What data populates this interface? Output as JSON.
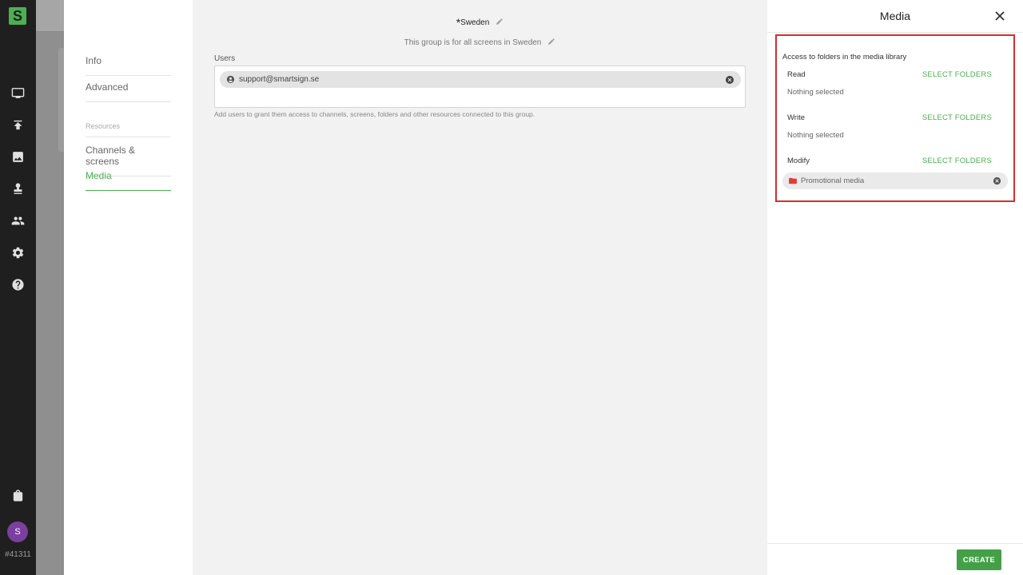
{
  "rail": {
    "logo_letter": "S",
    "icons": [
      "monitor-icon",
      "upload-icon",
      "image-icon",
      "stamp-icon",
      "people-icon",
      "gear-icon",
      "help-icon",
      "bag-icon"
    ],
    "avatar_letter": "S",
    "account_id": "#41311"
  },
  "nav": {
    "items": [
      {
        "label": "Info"
      },
      {
        "label": "Advanced"
      }
    ],
    "resources_heading": "Resources",
    "resources": [
      {
        "label": "Channels & screens"
      },
      {
        "label": "Media"
      }
    ]
  },
  "main": {
    "required_mark": "*",
    "group_name": "Sweden",
    "description": "This group is for all screens in Sweden",
    "users_label": "Users",
    "users": [
      {
        "email": "support@smartsign.se"
      }
    ],
    "hint": "Add users to grant them access to channels, screens, folders and other resources connected to this group."
  },
  "panel": {
    "title": "Media",
    "access_title": "Access to folders in the media library",
    "permissions": [
      {
        "label": "Read",
        "action": "SELECT FOLDERS",
        "empty_text": "Nothing selected"
      },
      {
        "label": "Write",
        "action": "SELECT FOLDERS",
        "empty_text": "Nothing selected"
      },
      {
        "label": "Modify",
        "action": "SELECT FOLDERS",
        "folders": [
          "Promotional media"
        ]
      }
    ],
    "create_label": "CREATE"
  },
  "colors": {
    "accent": "#4caf50",
    "highlight": "#d32f2f",
    "rail_bg": "#1f1f1f",
    "folder": "#e53935"
  }
}
